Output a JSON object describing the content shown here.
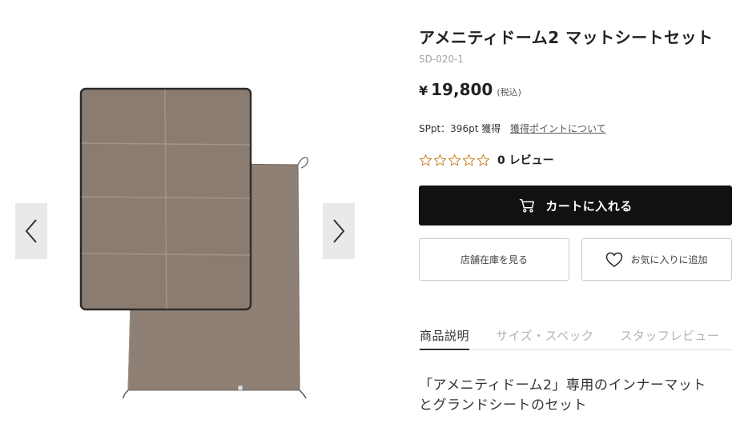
{
  "gallery": {
    "prev_icon": "chevron-left-icon",
    "next_icon": "chevron-right-icon"
  },
  "product": {
    "title": "アメニティドーム2 マットシートセット",
    "sku": "SD-020-1",
    "price_currency": "¥",
    "price_value": "19,800",
    "price_tax": "(税込)",
    "points_text": "SPpt：396pt 獲得",
    "points_link": "獲得ポイントについて",
    "rating_value": 0,
    "rating_max": 5,
    "review_count": "0 レビュー",
    "description_line1": "「アメニティドーム2」専用のインナーマット",
    "description_line2": "とグランドシートのセット"
  },
  "actions": {
    "cart_label": "カートに入れる",
    "cart_icon": "cart-icon",
    "store_label": "店舗在庫を見る",
    "favorite_label": "お気に入りに追加",
    "favorite_icon": "heart-icon"
  },
  "tabs": [
    {
      "label": "商品説明",
      "active": true
    },
    {
      "label": "サイズ・スペック",
      "active": false
    },
    {
      "label": "スタッフレビュー",
      "active": false
    }
  ],
  "colors": {
    "accent_star": "#c8801e",
    "button_dark": "#111111",
    "product_fabric": "#8c7d72"
  }
}
